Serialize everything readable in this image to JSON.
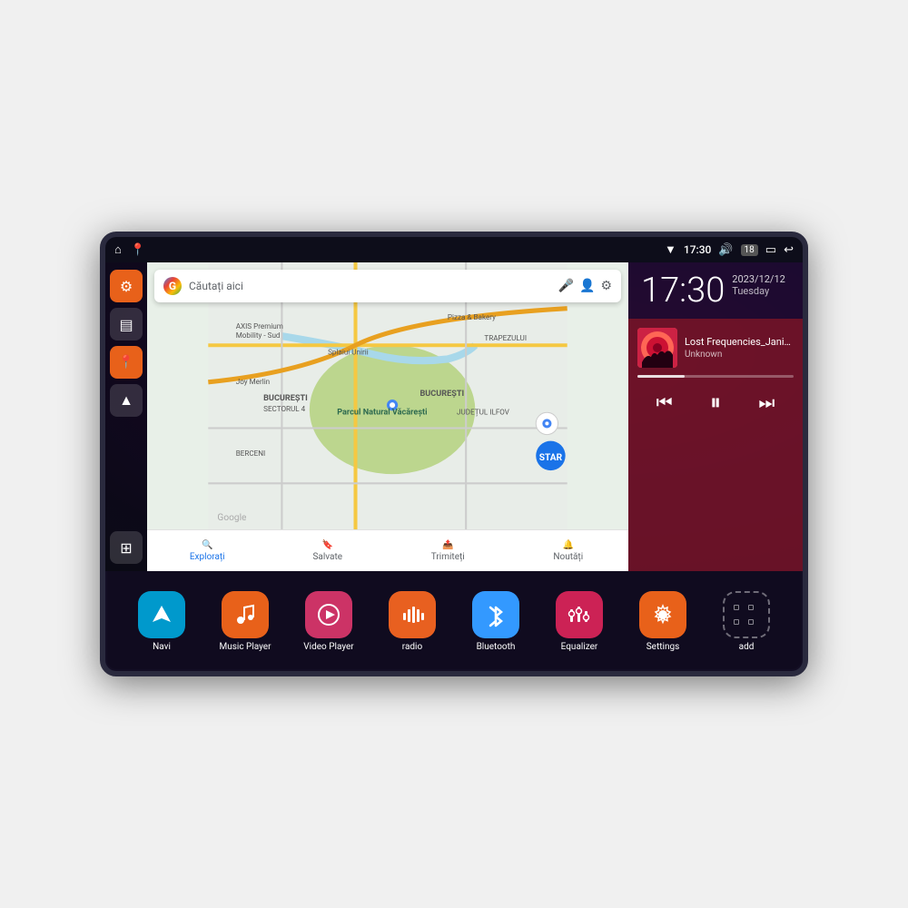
{
  "device": {
    "title": "Car Android Head Unit"
  },
  "status_bar": {
    "left_icons": [
      "⌂",
      "📍"
    ],
    "wifi_icon": "▼",
    "time": "17:30",
    "volume_icon": "🔊",
    "battery_badge": "18",
    "battery_icon": "🔋",
    "back_icon": "↩"
  },
  "map": {
    "search_placeholder": "Căutați aici",
    "locations": [
      "AXIS Premium Mobility - Sud",
      "Pizza & Bakery",
      "TRAPEZULUI",
      "Parcul Natural Văcărești",
      "BUCUREȘTI",
      "BUCUREȘTI SECTORUL 4",
      "JUDEȚUL ILFOV",
      "BERCENI",
      "Splaiui Unirii",
      "Joy Merlin"
    ],
    "bottom_tabs": [
      "Explorați",
      "Salvate",
      "Trimiteți",
      "Noutăți"
    ],
    "bottom_icons": [
      "🔍",
      "🔖",
      "📤",
      "🔔"
    ]
  },
  "clock": {
    "time": "17:30",
    "date": "2023/12/12",
    "day": "Tuesday"
  },
  "music": {
    "title": "Lost Frequencies_Janie...",
    "artist": "Unknown",
    "progress": 30
  },
  "apps": [
    {
      "id": "navi",
      "label": "Navi",
      "icon": "▲",
      "color": "#0099cc"
    },
    {
      "id": "music-player",
      "label": "Music Player",
      "icon": "♪",
      "color": "#e8611a"
    },
    {
      "id": "video-player",
      "label": "Video Player",
      "icon": "▶",
      "color": "#cc3366"
    },
    {
      "id": "radio",
      "label": "radio",
      "icon": "📻",
      "color": "#e86020"
    },
    {
      "id": "bluetooth",
      "label": "Bluetooth",
      "icon": "₿",
      "color": "#3399ff"
    },
    {
      "id": "equalizer",
      "label": "Equalizer",
      "icon": "≡",
      "color": "#cc2255"
    },
    {
      "id": "settings",
      "label": "Settings",
      "icon": "⚙",
      "color": "#e8611a"
    },
    {
      "id": "add",
      "label": "add",
      "icon": "+",
      "color": "transparent"
    }
  ],
  "sidebar": {
    "items": [
      {
        "id": "settings",
        "icon": "⚙",
        "type": "orange"
      },
      {
        "id": "files",
        "icon": "▤",
        "type": "dark"
      },
      {
        "id": "map",
        "icon": "📍",
        "type": "orange"
      },
      {
        "id": "navi",
        "icon": "▲",
        "type": "dark"
      }
    ],
    "grid_icon": "⊞"
  }
}
